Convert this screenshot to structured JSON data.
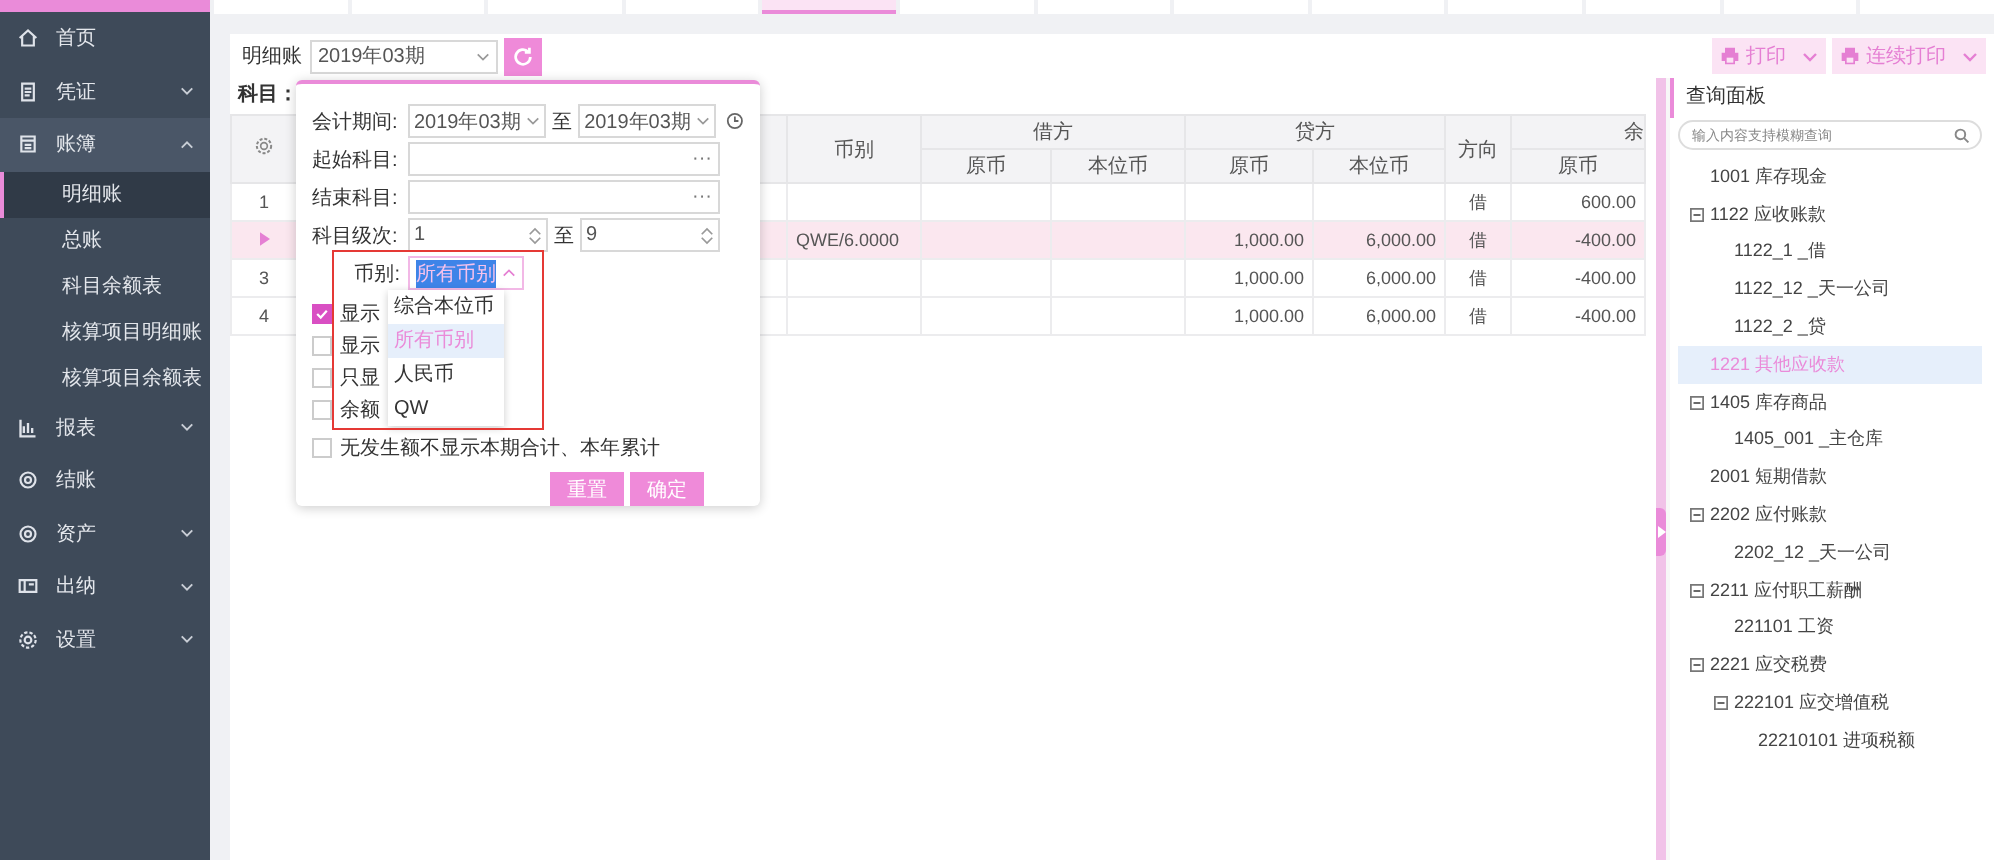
{
  "sidebar": {
    "items": [
      {
        "label": "首页",
        "kind": "link"
      },
      {
        "label": "凭证",
        "kind": "group",
        "expanded": false
      },
      {
        "label": "账簿",
        "kind": "group",
        "expanded": true,
        "children": [
          {
            "label": "明细账",
            "selected": true
          },
          {
            "label": "总账",
            "selected": false
          },
          {
            "label": "科目余额表",
            "selected": false
          },
          {
            "label": "核算项目明细账",
            "selected": false
          },
          {
            "label": "核算项目余额表",
            "selected": false
          }
        ]
      },
      {
        "label": "报表",
        "kind": "group",
        "expanded": false
      },
      {
        "label": "结账",
        "kind": "link"
      },
      {
        "label": "资产",
        "kind": "group",
        "expanded": false
      },
      {
        "label": "出纳",
        "kind": "group",
        "expanded": false
      },
      {
        "label": "设置",
        "kind": "group",
        "expanded": false
      }
    ]
  },
  "tabs": [
    {
      "selected": false
    },
    {
      "selected": false
    },
    {
      "selected": false
    },
    {
      "selected": false
    },
    {
      "selected": true
    },
    {
      "selected": false
    },
    {
      "selected": false
    },
    {
      "selected": false
    },
    {
      "selected": false
    },
    {
      "selected": false
    },
    {
      "selected": false
    },
    {
      "selected": false
    },
    {
      "selected": false
    }
  ],
  "toolbar": {
    "label": "明细账",
    "period": "2019年03期",
    "print": "打印",
    "continuous_print": "连续打印"
  },
  "subject_label": "科目：",
  "table": {
    "groups": [
      "币别",
      "借方",
      "贷方",
      "方向",
      "余"
    ],
    "subcolumns": [
      "原币",
      "本位币",
      "原币",
      "本位币",
      "原币"
    ],
    "rows": [
      {
        "index": "1",
        "selected": false,
        "currency": "",
        "debit_orig": "",
        "debit_base": "",
        "credit_orig": "",
        "credit_base": "",
        "direction": "借",
        "balance_orig": "600.00"
      },
      {
        "index": "",
        "selected": true,
        "currency": "QWE/6.0000",
        "debit_orig": "",
        "debit_base": "",
        "credit_orig": "1,000.00",
        "credit_base": "6,000.00",
        "direction": "借",
        "balance_orig": "-400.00"
      },
      {
        "index": "3",
        "selected": false,
        "currency": "",
        "debit_orig": "",
        "debit_base": "",
        "credit_orig": "1,000.00",
        "credit_base": "6,000.00",
        "direction": "借",
        "balance_orig": "-400.00"
      },
      {
        "index": "4",
        "selected": false,
        "currency": "",
        "debit_orig": "",
        "debit_base": "",
        "credit_orig": "1,000.00",
        "credit_base": "6,000.00",
        "direction": "借",
        "balance_orig": "-400.00"
      }
    ]
  },
  "filter_popup": {
    "period_label": "会计期间:",
    "period_from": "2019年03期",
    "period_separator": "至",
    "period_to": "2019年03期",
    "start_subject_label": "起始科目:",
    "start_subject_browse": "···",
    "end_subject_label": "结束科目:",
    "end_subject_browse": "···",
    "level_label": "科目级次:",
    "level_from": "1",
    "level_separator": "至",
    "level_to": "9",
    "currency_label": "币别:",
    "currency_value": "所有币别",
    "currency_options": [
      {
        "label": "综合本位币",
        "selected": false
      },
      {
        "label": "所有币别",
        "selected": true
      },
      {
        "label": "人民币",
        "selected": false
      },
      {
        "label": "QW",
        "selected": false
      }
    ],
    "checkboxes": [
      {
        "label": "显示",
        "checked": true
      },
      {
        "label": "显示",
        "checked": false
      },
      {
        "label": "只显",
        "checked": false
      },
      {
        "label": "余额",
        "checked": false
      },
      {
        "label": "无发生额不显示本期合计、本年累计",
        "checked": false
      }
    ],
    "reset": "重置",
    "confirm": "确定"
  },
  "query_panel": {
    "title": "查询面板",
    "search_placeholder": "输入内容支持模糊查询",
    "tree": [
      {
        "label": "1001 库存现金",
        "selected": false
      },
      {
        "label": "1122 应收账款",
        "selected": false,
        "expanded": true,
        "children": [
          {
            "label": "1122_1 _借",
            "selected": false
          },
          {
            "label": "1122_12 _天一公司",
            "selected": false
          },
          {
            "label": "1122_2 _贷",
            "selected": false
          }
        ]
      },
      {
        "label": "1221 其他应收款",
        "selected": true
      },
      {
        "label": "1405 库存商品",
        "selected": false,
        "expanded": true,
        "children": [
          {
            "label": "1405_001 _主仓库",
            "selected": false
          }
        ]
      },
      {
        "label": "2001 短期借款",
        "selected": false
      },
      {
        "label": "2202 应付账款",
        "selected": false,
        "expanded": true,
        "children": [
          {
            "label": "2202_12 _天一公司",
            "selected": false
          }
        ]
      },
      {
        "label": "2211 应付职工薪酬",
        "selected": false,
        "expanded": true,
        "children": [
          {
            "label": "221101 工资",
            "selected": false
          }
        ]
      },
      {
        "label": "2221 应交税费",
        "selected": false,
        "expanded": true,
        "children": [
          {
            "label": "222101 应交增值税",
            "selected": false,
            "expanded": true,
            "children": [
              {
                "label": "22210101 进项税额",
                "selected": false
              }
            ]
          }
        ]
      }
    ]
  }
}
